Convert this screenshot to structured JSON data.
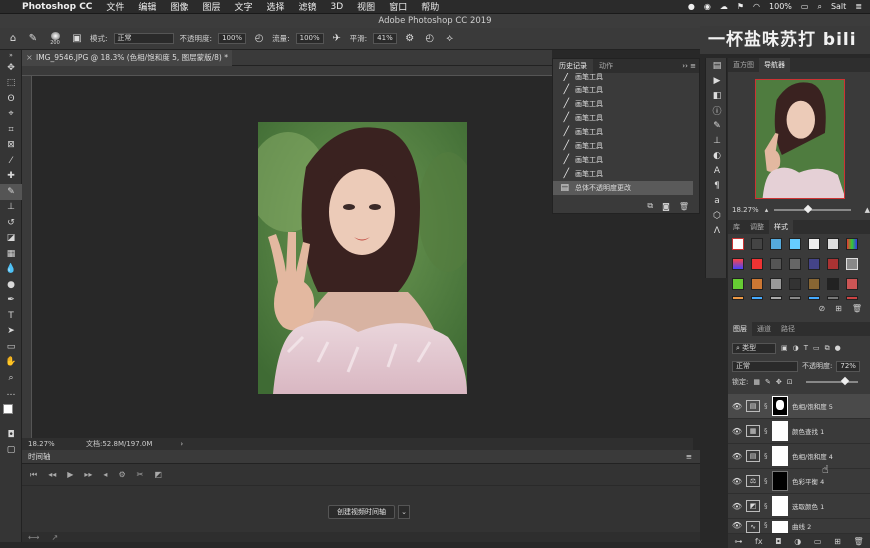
{
  "menubar": {
    "app_name": "Photoshop CC",
    "items": [
      "文件",
      "编辑",
      "图像",
      "图层",
      "文字",
      "选择",
      "滤镜",
      "3D",
      "视图",
      "窗口",
      "帮助"
    ],
    "battery": "100%",
    "user": "Salt"
  },
  "window_title": "Adobe Photoshop CC 2019",
  "options": {
    "brush_size": "200",
    "mode_label": "模式:",
    "mode_value": "正常",
    "opacity_label": "不透明度:",
    "opacity_value": "100%",
    "flow_label": "流量:",
    "flow_value": "100%",
    "smooth_label": "平滑:",
    "smooth_value": "41%"
  },
  "watermark": "一杯盐味苏打 bili",
  "document_tab": "IMG_9546.JPG @ 18.3% (色相/饱和度 5, 图层蒙版/8) *",
  "status": {
    "zoom": "18.27%",
    "doc_size": "文档:52.8M/197.0M"
  },
  "timeline": {
    "title": "时间轴",
    "create_button": "创建视频时间轴"
  },
  "history": {
    "tabs": [
      "历史记录",
      "动作"
    ],
    "rows": [
      "画笔工具",
      "画笔工具",
      "画笔工具",
      "画笔工具",
      "画笔工具",
      "画笔工具",
      "画笔工具",
      "画笔工具"
    ],
    "selected_row": "总体不透明度更改"
  },
  "navigator": {
    "tabs": [
      "直方图",
      "导航器"
    ],
    "zoom": "18.27%"
  },
  "libraries": {
    "tabs": [
      "库",
      "调整",
      "样式"
    ]
  },
  "layers_panel": {
    "tabs": [
      "图层",
      "通道",
      "路径"
    ],
    "filter_label": "类型",
    "blend_mode": "正常",
    "opacity_label": "不透明度:",
    "opacity_value": "72%",
    "lock_label": "锁定:",
    "layers": [
      {
        "name": "色相/饱和度 5",
        "icon": "hue-saturation-icon",
        "selected": true,
        "mask": "black-with-white"
      },
      {
        "name": "颜色查找 1",
        "icon": "color-lookup-icon",
        "selected": false,
        "mask": "white"
      },
      {
        "name": "色相/饱和度 4",
        "icon": "hue-saturation-icon",
        "selected": false,
        "mask": "white"
      },
      {
        "name": "色彩平衡 4",
        "icon": "color-balance-icon",
        "selected": false,
        "mask": "black"
      },
      {
        "name": "选取颜色 1",
        "icon": "selective-color-icon",
        "selected": false,
        "mask": "white"
      },
      {
        "name": "曲线 2",
        "icon": "curves-icon",
        "selected": false,
        "mask": "white"
      }
    ]
  }
}
